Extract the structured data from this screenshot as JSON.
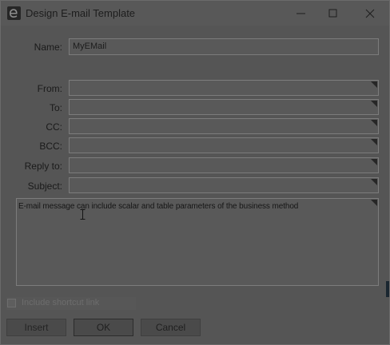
{
  "window": {
    "title": "Design E-mail Template",
    "app_icon_letter": "e"
  },
  "form": {
    "name_label": "Name:",
    "name_value": "MyEMail",
    "from_label": "From:",
    "from_value": "",
    "to_label": "To:",
    "to_value": "",
    "cc_label": "CC:",
    "cc_value": "",
    "bcc_label": "BCC:",
    "bcc_value": "",
    "reply_to_label": "Reply to:",
    "reply_to_value": "",
    "subject_label": "Subject:",
    "subject_value": "",
    "body_value": "E-mail message can include scalar and table parameters of the business method"
  },
  "options": {
    "include_shortcut_label": "Include shortcut link",
    "include_shortcut_checked": false
  },
  "buttons": {
    "insert": "Insert",
    "ok": "OK",
    "cancel": "Cancel"
  },
  "icons": {
    "app": "app-logo-icon",
    "minimize": "minimize-icon",
    "maximize": "maximize-icon",
    "close": "close-icon",
    "field_menu": "field-menu-corner-icon",
    "text_cursor": "text-cursor-icon"
  }
}
